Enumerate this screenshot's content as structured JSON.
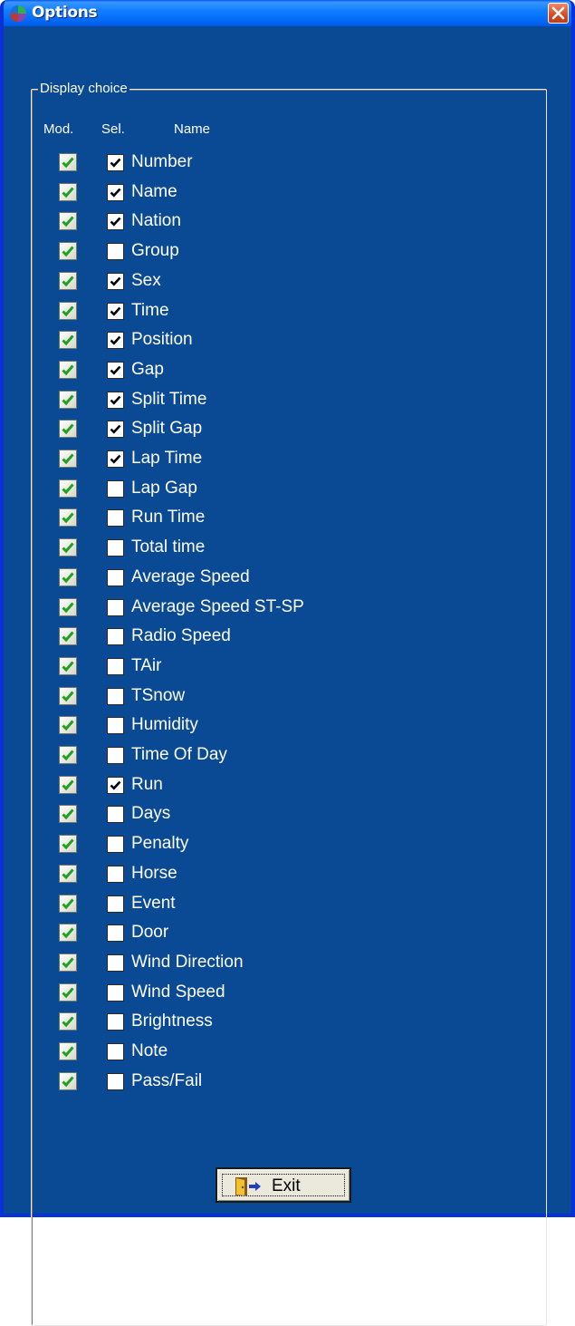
{
  "window": {
    "title": "Options",
    "app_icon": "app-logo-icon",
    "close_icon": "close-icon"
  },
  "group": {
    "legend": "Display choice",
    "headers": {
      "mod": "Mod.",
      "sel": "Sel.",
      "name": "Name"
    }
  },
  "fields": [
    {
      "label": "Number",
      "mod": true,
      "sel": true
    },
    {
      "label": "Name",
      "mod": true,
      "sel": true
    },
    {
      "label": "Nation",
      "mod": true,
      "sel": true
    },
    {
      "label": "Group",
      "mod": true,
      "sel": false
    },
    {
      "label": "Sex",
      "mod": true,
      "sel": true
    },
    {
      "label": "Time",
      "mod": true,
      "sel": true
    },
    {
      "label": "Position",
      "mod": true,
      "sel": true
    },
    {
      "label": "Gap",
      "mod": true,
      "sel": true
    },
    {
      "label": "Split Time",
      "mod": true,
      "sel": true
    },
    {
      "label": "Split Gap",
      "mod": true,
      "sel": true
    },
    {
      "label": "Lap Time",
      "mod": true,
      "sel": true
    },
    {
      "label": "Lap Gap",
      "mod": true,
      "sel": false
    },
    {
      "label": "Run Time",
      "mod": true,
      "sel": false
    },
    {
      "label": "Total time",
      "mod": true,
      "sel": false
    },
    {
      "label": "Average Speed",
      "mod": true,
      "sel": false
    },
    {
      "label": "Average Speed ST-SP",
      "mod": true,
      "sel": false
    },
    {
      "label": "Radio Speed",
      "mod": true,
      "sel": false
    },
    {
      "label": "TAir",
      "mod": true,
      "sel": false
    },
    {
      "label": "TSnow",
      "mod": true,
      "sel": false
    },
    {
      "label": "Humidity",
      "mod": true,
      "sel": false
    },
    {
      "label": "Time Of Day",
      "mod": true,
      "sel": false
    },
    {
      "label": "Run",
      "mod": true,
      "sel": true
    },
    {
      "label": "Days",
      "mod": true,
      "sel": false
    },
    {
      "label": "Penalty",
      "mod": true,
      "sel": false
    },
    {
      "label": "Horse",
      "mod": true,
      "sel": false
    },
    {
      "label": "Event",
      "mod": true,
      "sel": false
    },
    {
      "label": "Door",
      "mod": true,
      "sel": false
    },
    {
      "label": "Wind Direction",
      "mod": true,
      "sel": false
    },
    {
      "label": "Wind Speed",
      "mod": true,
      "sel": false
    },
    {
      "label": "Brightness",
      "mod": true,
      "sel": false
    },
    {
      "label": "Note",
      "mod": true,
      "sel": false
    },
    {
      "label": "Pass/Fail",
      "mod": true,
      "sel": false
    }
  ],
  "footer": {
    "exit_label": "Exit",
    "exit_icon": "exit-door-icon"
  },
  "colors": {
    "window_bg": "#0a4a94",
    "titlebar": "#0a5fe8",
    "mod_check": "#21a121"
  }
}
